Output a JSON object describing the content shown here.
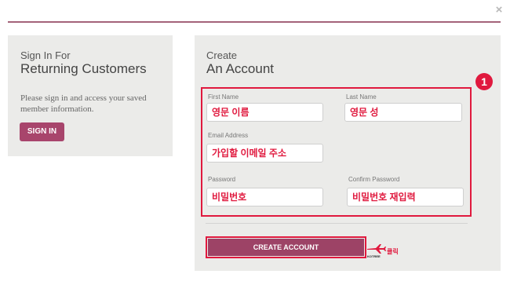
{
  "dialog": {
    "close_label": "×"
  },
  "sign_in": {
    "subtitle": "Sign In For",
    "title": "Returning Customers",
    "description": "Please sign in and access your saved member information.",
    "button_label": "SIGN IN"
  },
  "create": {
    "subtitle": "Create",
    "title": "An Account",
    "step_badge": "1",
    "fields": {
      "first_name": {
        "label": "First Name",
        "value": "영문 이름"
      },
      "last_name": {
        "label": "Last Name",
        "value": "영문 성"
      },
      "email": {
        "label": "Email Address",
        "value": "가입할 이메일 주소"
      },
      "password": {
        "label": "Password",
        "value": "비밀번호"
      },
      "confirm_password": {
        "label": "Confirm Password",
        "value": "비밀번호 재입력"
      }
    },
    "button_label": "CREATE ACCOUNT",
    "click_hint": {
      "brand": "KOTREE",
      "label": "클릭"
    }
  },
  "colors": {
    "accent": "#a8456c",
    "highlight": "#e0193e",
    "panel": "#ebebe9"
  }
}
